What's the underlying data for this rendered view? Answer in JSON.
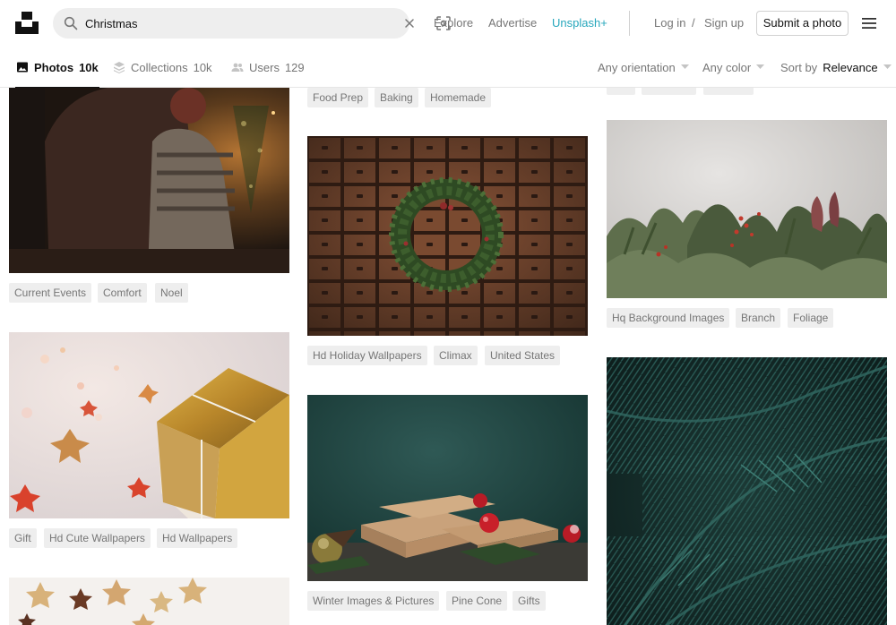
{
  "header": {
    "search_value": "Christmas",
    "nav": {
      "explore": "Explore",
      "advertise": "Advertise",
      "plus": "Unsplash+"
    },
    "login": "Log in",
    "separator": "/",
    "signup": "Sign up",
    "submit": "Submit a photo",
    "accent_color": "#27a7bc"
  },
  "filters": {
    "tabs": [
      {
        "label": "Photos",
        "count": "10k",
        "icon": "photo-icon"
      },
      {
        "label": "Collections",
        "count": "10k",
        "icon": "collections-icon"
      },
      {
        "label": "Users",
        "count": "129",
        "icon": "users-icon"
      }
    ],
    "orientation": "Any orientation",
    "color": "Any color",
    "sort_prefix": "Sort by",
    "sort_value": "Relevance"
  },
  "columns": {
    "col1": {
      "photo1_tags": [
        "Current Events",
        "Comfort",
        "Noel"
      ],
      "photo2_tags": [
        "Gift",
        "Hd Cute Wallpapers",
        "Hd Wallpapers"
      ]
    },
    "col2": {
      "top_tags": [
        "Food Prep",
        "Baking",
        "Homemade"
      ],
      "photo1_tags": [
        "Hd Holiday Wallpapers",
        "Climax",
        "United States"
      ],
      "photo2_tags": [
        "Winter Images & Pictures",
        "Pine Cone",
        "Gifts"
      ]
    },
    "col3": {
      "photo1_tags": [
        "Hq Background Images",
        "Branch",
        "Foliage"
      ]
    }
  }
}
